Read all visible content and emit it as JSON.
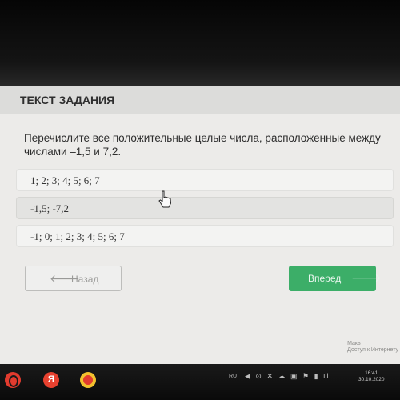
{
  "header": {
    "title": "ТЕКСТ ЗАДАНИЯ"
  },
  "question": {
    "text": "Перечислите все положительные целые числа, расположенные между числами –1,5 и 7,2."
  },
  "options": [
    {
      "text": "1; 2; 3; 4; 5; 6; 7"
    },
    {
      "text": "-1,5; -7,2"
    },
    {
      "text": "-1; 0; 1; 2; 3; 4; 5; 6; 7"
    }
  ],
  "nav": {
    "back_label": "Назад",
    "next_label": "Вперед"
  },
  "watermark": {
    "line1": "Макв",
    "line2": "Доступ к Интернету"
  },
  "taskbar": {
    "language": "RU",
    "time": "16:41",
    "date": "30.10.2020",
    "yandex_label": "Я",
    "tray_icons": "◀ ⊙ ✕ ☁ ▣ ⚑ ▮ ıl"
  },
  "colors": {
    "accent": "#3cae68",
    "background": "#ecebe9",
    "header": "#dcdcda"
  },
  "icons": {
    "back": "arrow-left-icon",
    "next": "arrow-right-icon",
    "cursor": "hand-pointer-icon"
  }
}
